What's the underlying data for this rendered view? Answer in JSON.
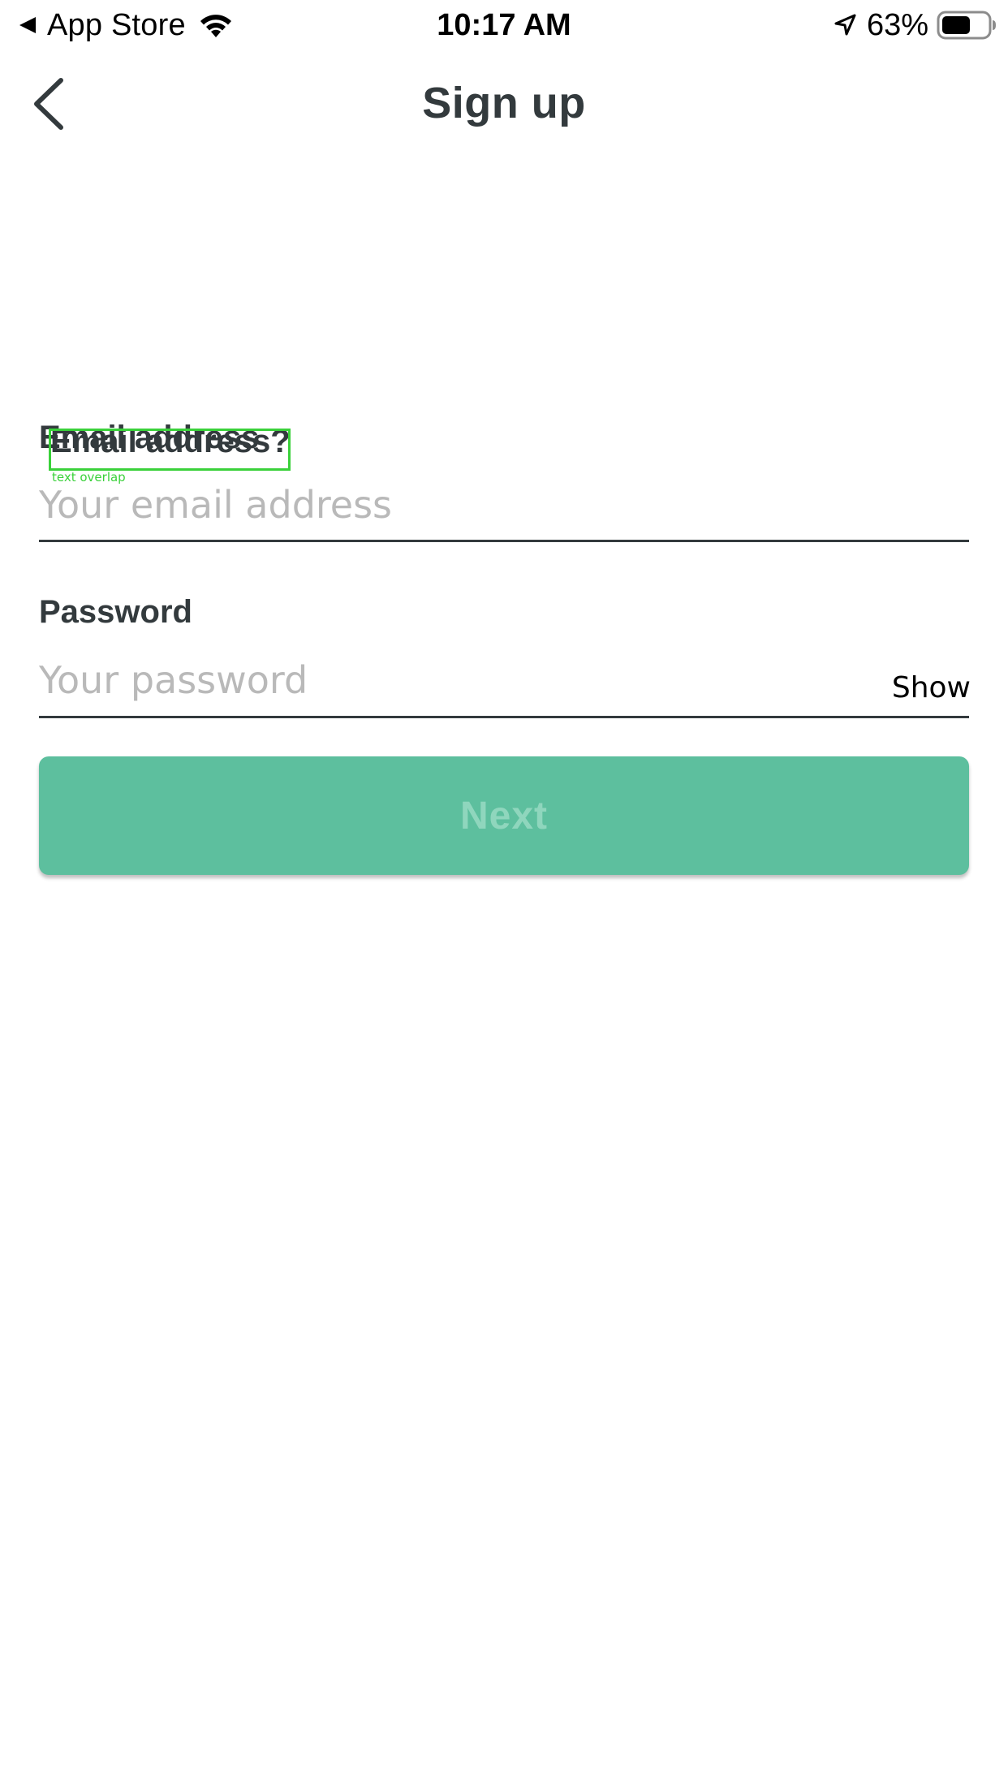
{
  "status_bar": {
    "back_app_label": "App Store",
    "time": "10:17 AM",
    "battery_percent": "63%",
    "battery_level": 0.63,
    "icons": [
      "back-triangle-icon",
      "wifi-icon",
      "location-arrow-icon",
      "battery-icon"
    ]
  },
  "nav": {
    "title": "Sign up",
    "back_icon": "chevron-left-icon"
  },
  "form": {
    "email": {
      "label": "Email address",
      "overlap_label": "Email address?",
      "placeholder": "Your email address",
      "value": ""
    },
    "password": {
      "label": "Password",
      "placeholder": "Your password",
      "value": "",
      "toggle_label": "Show"
    },
    "debug_overlay": {
      "tag": "text overlap",
      "color": "#3ad13a"
    },
    "next_label": "Next"
  },
  "colors": {
    "accent": "#5dbf9e",
    "button_text": "#8fd6bd",
    "text_dark": "#333a3d",
    "placeholder": "#b9b9b9"
  }
}
